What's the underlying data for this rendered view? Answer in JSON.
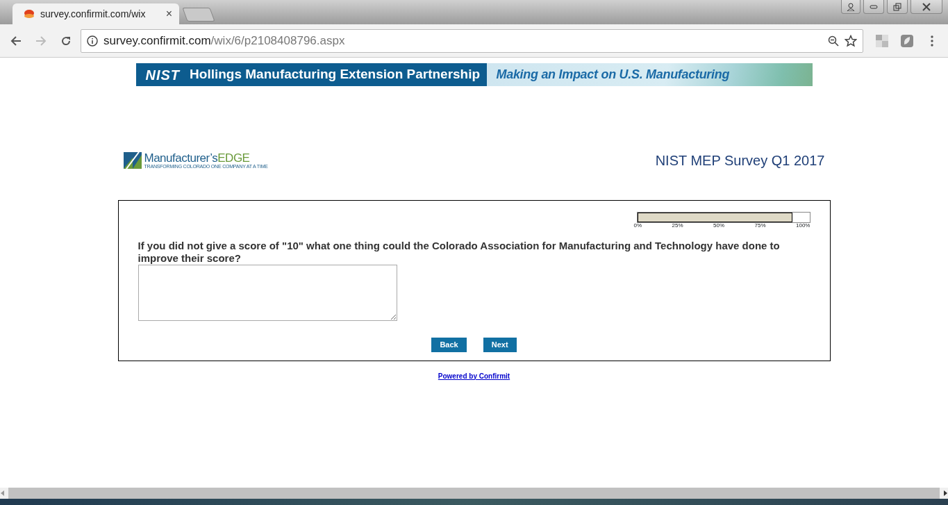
{
  "browser": {
    "tab": {
      "title": "survey.confirmit.com/wix",
      "close": "×"
    },
    "address": {
      "host": "survey.confirmit.com",
      "path": "/wix/6/p2108408796.aspx"
    }
  },
  "banner": {
    "logo": "NIST",
    "title": "Hollings Manufacturing Extension Partnership",
    "tagline": "Making an Impact on U.S. Manufacturing"
  },
  "header": {
    "logo_name": "Manufacturer’s",
    "logo_accent": "EDGE",
    "logo_tagline": "TRANSFORMING COLORADO ONE COMPANY AT A TIME",
    "survey_title": "NIST MEP Survey Q1 2017"
  },
  "progress": {
    "level": 0.9,
    "ticks": [
      "0%",
      "25%",
      "50%",
      "75%",
      "100%"
    ]
  },
  "question": {
    "text": "If you did not give a score of \"10\" what one thing could the Colorado Association for Manufacturing and Technology have done to improve their score?"
  },
  "buttons": [
    "Back",
    "Next"
  ],
  "footer_link": "Powered by Confirmit"
}
